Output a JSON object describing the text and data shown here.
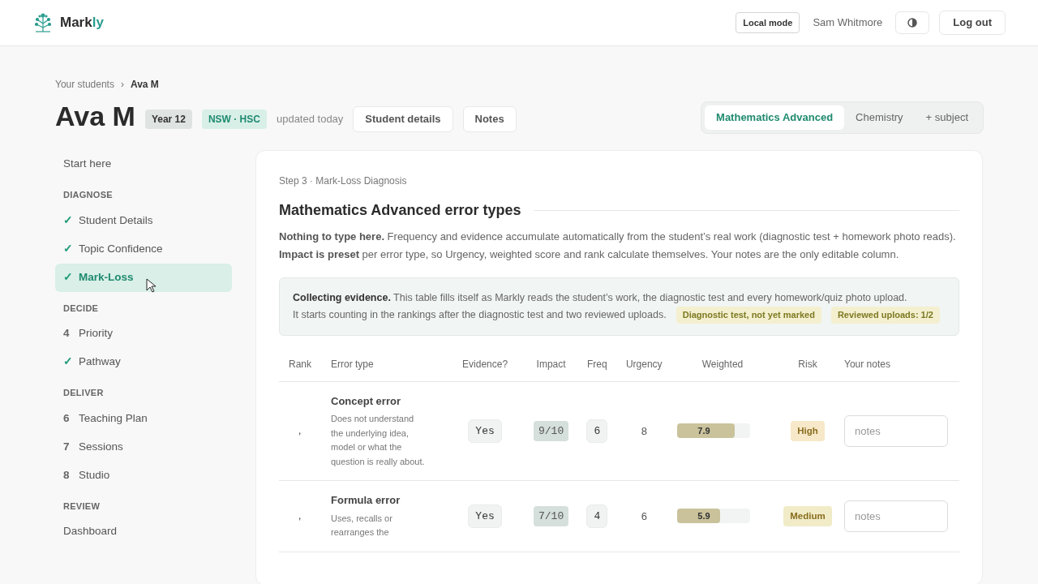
{
  "header": {
    "brand": {
      "main": "Mark",
      "accent": "ly"
    },
    "mode_badge": "Local mode",
    "user": "Sam Whitmore",
    "logout": "Log out"
  },
  "breadcrumb": {
    "parent": "Your students",
    "separator": "›",
    "current": "Ava M"
  },
  "student": {
    "name": "Ava M",
    "tags": [
      {
        "label": "Year 12",
        "kind": "grey"
      },
      {
        "label": "NSW · HSC",
        "kind": "green"
      }
    ],
    "updated": "updated today",
    "buttons": [
      "Student details",
      "Notes"
    ]
  },
  "subjects": [
    {
      "label": "Mathematics Advanced",
      "selected": true
    },
    {
      "label": "Chemistry",
      "selected": false
    },
    {
      "label": "+ subject",
      "selected": false
    }
  ],
  "sidebar": [
    {
      "kind": "item",
      "label": "Start here",
      "selected": false
    },
    {
      "kind": "heading",
      "label": "DIAGNOSE"
    },
    {
      "kind": "step",
      "marker": "✓",
      "done": true,
      "label": "Student Details",
      "selected": false
    },
    {
      "kind": "step",
      "marker": "✓",
      "done": true,
      "label": "Topic Confidence",
      "selected": false
    },
    {
      "kind": "step",
      "marker": "✓",
      "done": true,
      "label": "Mark-Loss",
      "selected": true
    },
    {
      "kind": "heading",
      "label": "DECIDE"
    },
    {
      "kind": "step",
      "marker": "4",
      "done": false,
      "label": "Priority",
      "selected": false
    },
    {
      "kind": "step",
      "marker": "✓",
      "done": true,
      "label": "Pathway",
      "selected": false
    },
    {
      "kind": "heading",
      "label": "DELIVER"
    },
    {
      "kind": "step",
      "marker": "6",
      "done": false,
      "label": "Teaching Plan",
      "selected": false
    },
    {
      "kind": "step",
      "marker": "7",
      "done": false,
      "label": "Sessions",
      "selected": false
    },
    {
      "kind": "step",
      "marker": "8",
      "done": false,
      "label": "Studio",
      "selected": false
    },
    {
      "kind": "heading",
      "label": "REVIEW"
    },
    {
      "kind": "item",
      "label": "Dashboard",
      "selected": false
    }
  ],
  "panel": {
    "step": "Step 3 · Mark-Loss Diagnosis",
    "title": "Mathematics Advanced error types",
    "intro": "**Nothing to type here.** Frequency and evidence accumulate automatically from the student’s real work (diagnostic test + homework photo reads). **Impact is preset** per error type, so Urgency, weighted score and rank calculate themselves. Your notes are the only editable column.",
    "notice": {
      "text": "**Collecting evidence.** This table fills itself as Markly reads the student’s work, the diagnostic test and every homework/quiz photo upload.",
      "text_2": "It starts counting in the rankings after the diagnostic test and two reviewed uploads.",
      "chips": [
        "Diagnostic test, not yet marked",
        "Reviewed uploads: 1/2"
      ]
    },
    "table": {
      "columns": [
        "Rank",
        "Error type",
        "Evidence?",
        "Impact",
        "Freq",
        "Urgency",
        "Weighted",
        "Risk",
        "Your notes"
      ],
      "rows": [
        {
          "rank": ",",
          "name": "Concept error",
          "description": "Does not understand the underlying idea, model or what the question is really about.",
          "evidence": "Yes",
          "impact": "9/10",
          "freq": "6",
          "urgency": "8",
          "weighted": "7.9",
          "level": 0.79,
          "risk": "High",
          "color": "#f6e8c8",
          "notes_placeholder": "notes"
        },
        {
          "rank": ",",
          "name": "Formula error",
          "description": "Uses, recalls or rearranges the",
          "evidence": "Yes",
          "impact": "7/10",
          "freq": "4",
          "urgency": "6",
          "weighted": "5.9",
          "level": 0.59,
          "risk": "Medium",
          "color": "#f1ecc7",
          "notes_placeholder": "notes"
        }
      ]
    }
  }
}
